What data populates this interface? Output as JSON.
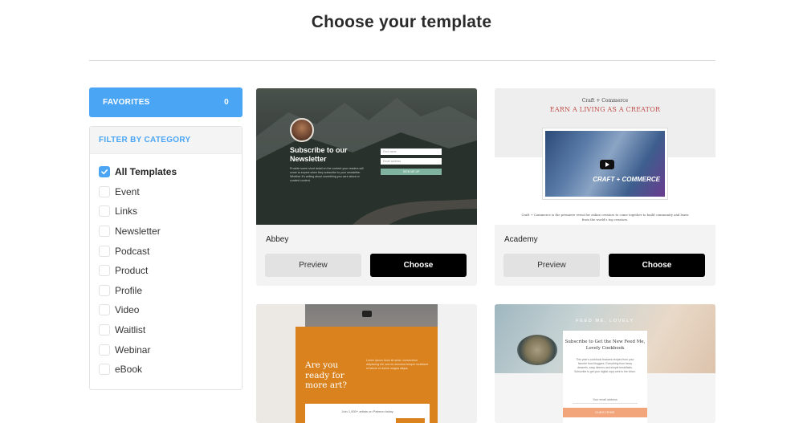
{
  "page": {
    "title": "Choose your template"
  },
  "sidebar": {
    "favorites_label": "FAVORITES",
    "favorites_count": "0",
    "filter_header": "FILTER BY CATEGORY",
    "categories": [
      {
        "label": "All Templates",
        "checked": true
      },
      {
        "label": "Event",
        "checked": false
      },
      {
        "label": "Links",
        "checked": false
      },
      {
        "label": "Newsletter",
        "checked": false
      },
      {
        "label": "Podcast",
        "checked": false
      },
      {
        "label": "Product",
        "checked": false
      },
      {
        "label": "Profile",
        "checked": false
      },
      {
        "label": "Video",
        "checked": false
      },
      {
        "label": "Waitlist",
        "checked": false
      },
      {
        "label": "Webinar",
        "checked": false
      },
      {
        "label": "eBook",
        "checked": false
      }
    ]
  },
  "templates": [
    {
      "name": "Abbey",
      "preview_label": "Preview",
      "choose_label": "Choose",
      "thumb": {
        "heading": "Subscribe to our Newsletter",
        "body": "Provide some short detail on the content your readers will come to expect when they subscribe to your newsletter. Whether it's writing about something you care about or curated content.",
        "field1": "First name",
        "field2": "Email address",
        "button": "SIGN ME UP"
      }
    },
    {
      "name": "Academy",
      "preview_label": "Preview",
      "choose_label": "Choose",
      "thumb": {
        "kicker": "Craft + Commerce",
        "headline": "EARN A LIVING AS A CREATOR",
        "brand": "CRAFT + COMMERCE",
        "caption": "Craft + Commerce is the premiere event for online creators to come together to build community and learn from the world's top creators."
      }
    },
    {
      "thumb": {
        "heading": "Are you ready for more art?",
        "body": "Lorem ipsum dolor sit amet, consectetur adipiscing elit, sed do eiusmod tempor incididunt ut labore et dolore magna aliqua.",
        "form_label": "Join 1,000+ artists on Patreon today"
      }
    },
    {
      "thumb": {
        "kicker": "FEED ME, LOVELY",
        "heading": "Subscribe to Get the New Feed Me, Lovely Cookbook",
        "body": "This year's cookbook features recipes from your favorite food bloggers. Everything from fancy desserts, easy dinners and simple breakfasts. Subscribe to get your digital copy sent to the inbox.",
        "email": "Your email address",
        "button": "SUBSCRIBE"
      }
    }
  ],
  "colors": {
    "accent": "#4aa6f5",
    "choose_bg": "#000000",
    "preview_bg": "#e2e2e2"
  }
}
